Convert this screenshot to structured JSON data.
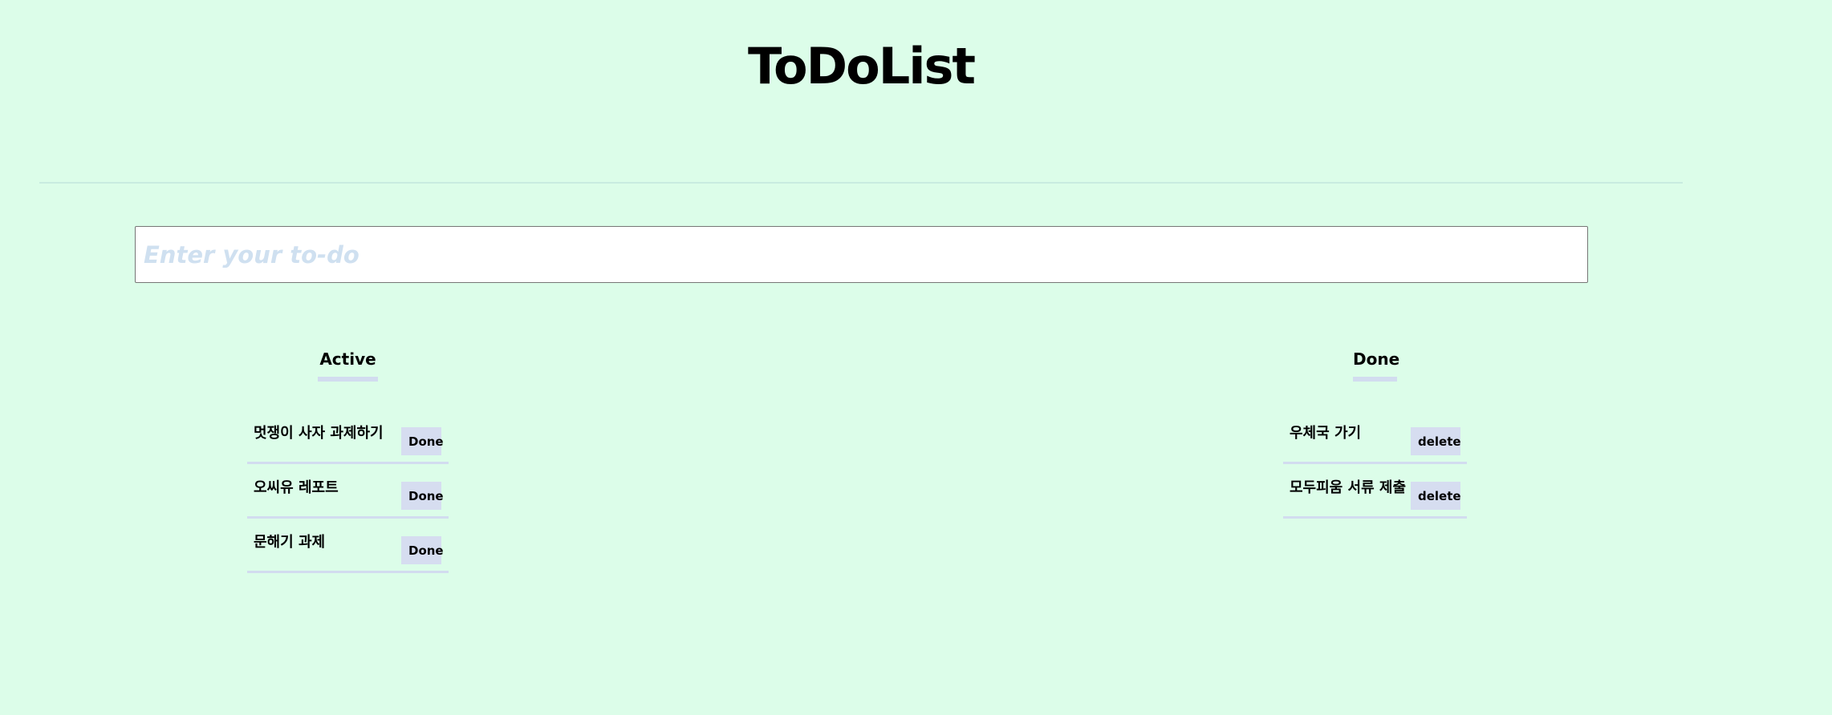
{
  "header": {
    "title": "ToDoList"
  },
  "input": {
    "placeholder": "Enter your to-do",
    "value": ""
  },
  "active": {
    "heading": "Active",
    "button_label": "Done",
    "items": [
      {
        "text": "멋쟁이 사자 과제하기"
      },
      {
        "text": "오씨유 레포트"
      },
      {
        "text": "문해기 과제"
      }
    ]
  },
  "done": {
    "heading": "Done",
    "button_label": "delete",
    "items": [
      {
        "text": "우체국 가기"
      },
      {
        "text": "모두피움 서류 제출"
      }
    ]
  },
  "colors": {
    "background": "#dcfde9",
    "underline": "#d2dcef",
    "button": "#d6ddf0",
    "placeholder": "#cfe0f0"
  }
}
